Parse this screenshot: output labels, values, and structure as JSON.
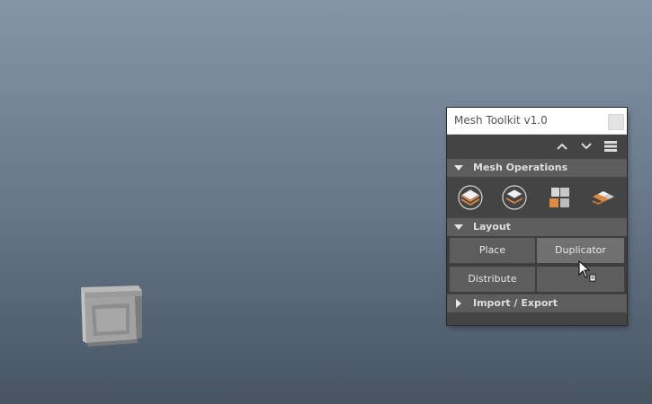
{
  "window": {
    "title": "Mesh Toolkit v1.0"
  },
  "sections": {
    "mesh_operations": {
      "label": "Mesh Operations",
      "icons": [
        "layers-icon",
        "layer-swap-icon",
        "grid-split-icon",
        "tiles-icon"
      ]
    },
    "layout": {
      "label": "Layout",
      "buttons": {
        "place": "Place",
        "duplicator": "Duplicator",
        "distribute": "Distribute"
      }
    },
    "import_export": {
      "label": "Import / Export"
    }
  },
  "colors": {
    "accent_orange": "#e0893f",
    "panel_bg": "#444444",
    "section_bg": "#5d5d5d"
  }
}
